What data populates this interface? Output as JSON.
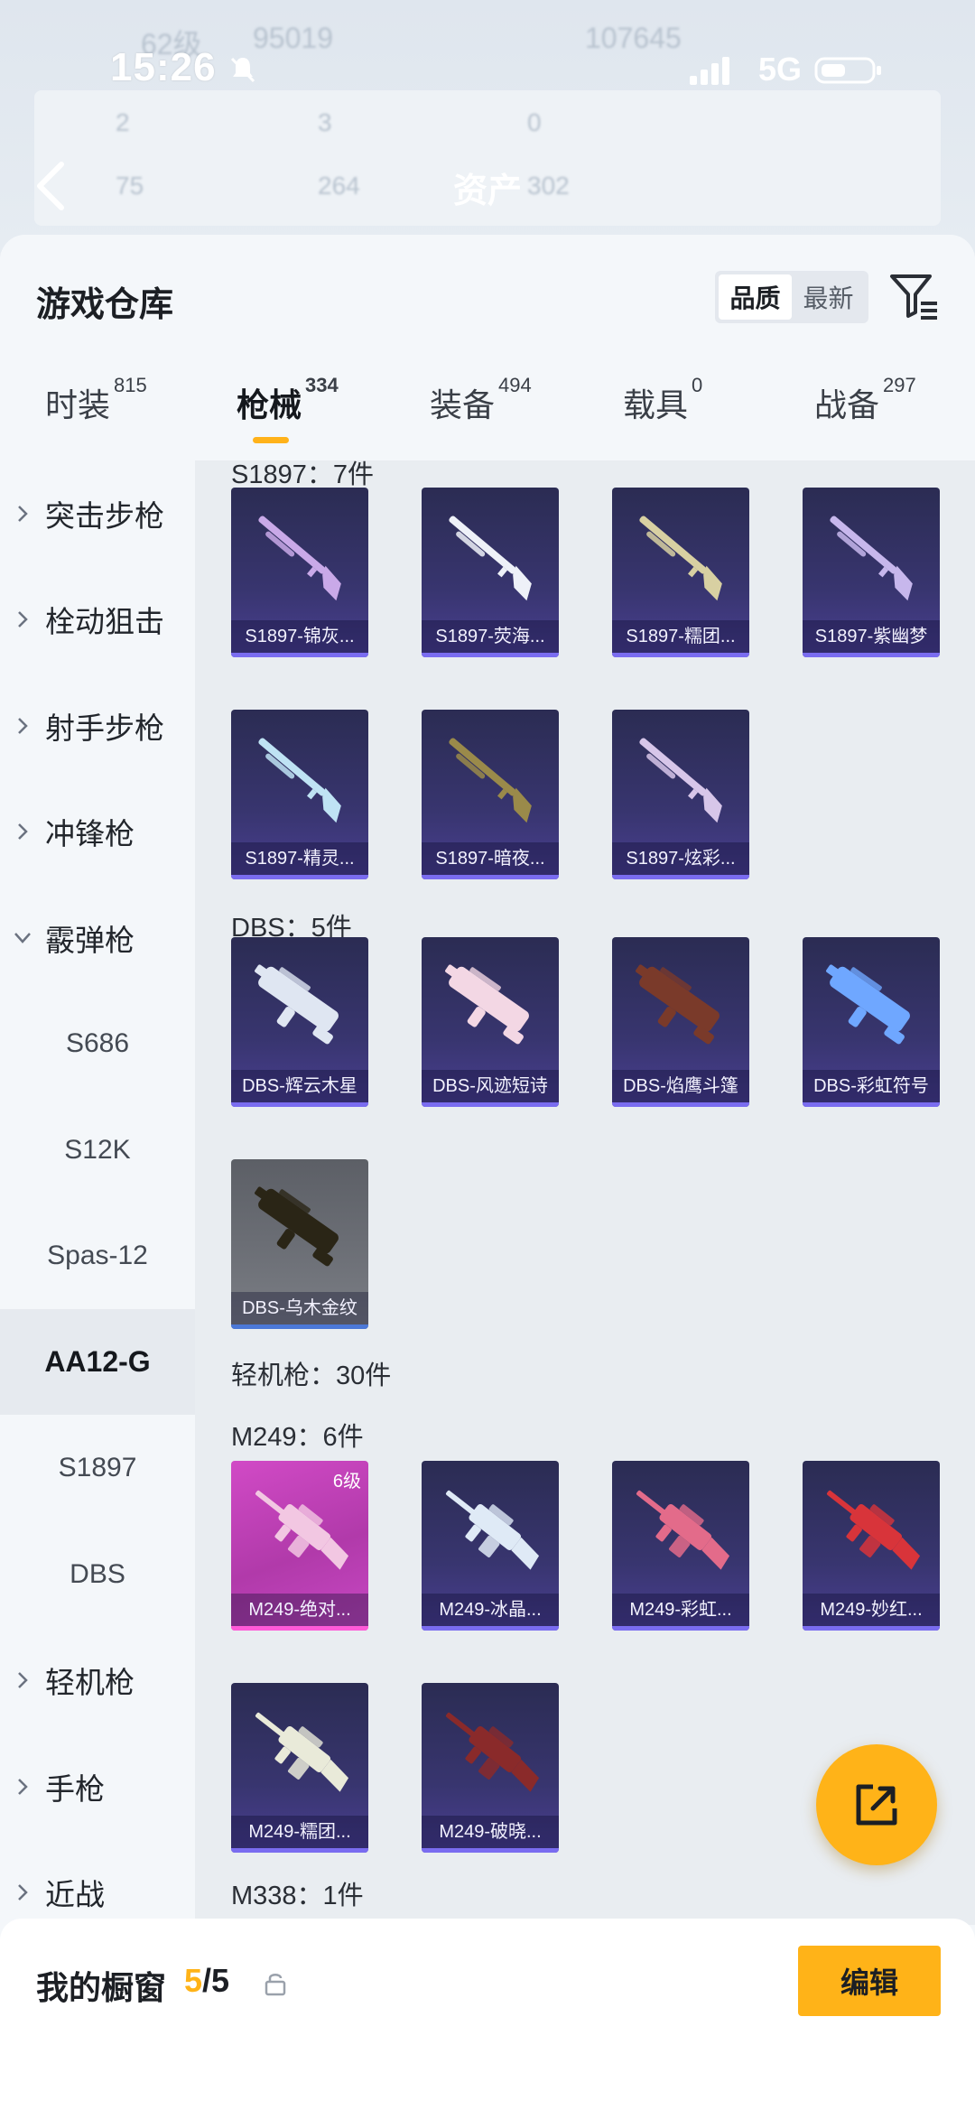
{
  "status_bar": {
    "time": "15:26",
    "network": "5G"
  },
  "background_header": {
    "blur_level": "62级",
    "blur_coins": "95019",
    "blur_points": "107645",
    "blur_stats_row1": [
      "2",
      "3",
      "0"
    ],
    "blur_stats_row2": [
      "75",
      "264",
      "302"
    ],
    "assets_label": "资产"
  },
  "warehouse": {
    "title": "游戏仓库",
    "sort_options": [
      "品质",
      "最新"
    ],
    "sort_selected": "品质"
  },
  "tabs": [
    {
      "label": "时装",
      "count": "815"
    },
    {
      "label": "枪械",
      "count": "334"
    },
    {
      "label": "装备",
      "count": "494"
    },
    {
      "label": "载具",
      "count": "0"
    },
    {
      "label": "战备",
      "count": "297"
    }
  ],
  "sidenav": [
    {
      "label": "突击步枪",
      "type": "category"
    },
    {
      "label": "栓动狙击",
      "type": "category"
    },
    {
      "label": "射手步枪",
      "type": "category"
    },
    {
      "label": "冲锋枪",
      "type": "category"
    },
    {
      "label": "霰弹枪",
      "type": "category-open"
    },
    {
      "label": "S686",
      "type": "sub"
    },
    {
      "label": "S12K",
      "type": "sub"
    },
    {
      "label": "Spas-12",
      "type": "sub"
    },
    {
      "label": "AA12-G",
      "type": "sub-selected"
    },
    {
      "label": "S1897",
      "type": "sub"
    },
    {
      "label": "DBS",
      "type": "sub"
    },
    {
      "label": "轻机枪",
      "type": "category"
    },
    {
      "label": "手枪",
      "type": "category"
    },
    {
      "label": "近战",
      "type": "category"
    }
  ],
  "groups": {
    "s1897_label": "S1897：7件",
    "dbs_label": "DBS：5件",
    "lmg_label": "轻机枪：30件",
    "m249_label": "M249：6件",
    "m338_label": "M338：1件"
  },
  "items": [
    {
      "name": "S1897-锦灰...",
      "style": "purple",
      "gun": "shotgun",
      "color": "#c9a9e8"
    },
    {
      "name": "S1897-荧海...",
      "style": "purple",
      "gun": "shotgun",
      "color": "#eef1f8"
    },
    {
      "name": "S1897-糯团...",
      "style": "purple",
      "gun": "shotgun",
      "color": "#d8d0a2"
    },
    {
      "name": "S1897-紫幽梦",
      "style": "purple",
      "gun": "shotgun",
      "color": "#c7b7ec"
    },
    {
      "name": "S1897-精灵...",
      "style": "purple",
      "gun": "shotgun",
      "color": "#bfe3f4"
    },
    {
      "name": "S1897-暗夜...",
      "style": "purple",
      "gun": "shotgun",
      "color": "#9a8a4a"
    },
    {
      "name": "S1897-炫彩...",
      "style": "purple",
      "gun": "shotgun",
      "color": "#d7c6e9"
    },
    {
      "name": "DBS-辉云木星",
      "style": "purple",
      "gun": "dbs",
      "color": "#dfe6f2"
    },
    {
      "name": "DBS-风迹短诗",
      "style": "purple",
      "gun": "dbs",
      "color": "#f3d7e4"
    },
    {
      "name": "DBS-焰鹰斗篷",
      "style": "purple",
      "gun": "dbs",
      "color": "#7a3a2a"
    },
    {
      "name": "DBS-彩虹符号",
      "style": "purple",
      "gun": "dbs",
      "color": "#6fa7ff"
    },
    {
      "name": "DBS-乌木金纹",
      "style": "grey",
      "gun": "dbs",
      "color": "#2a2516"
    },
    {
      "name": "M249-绝对...",
      "style": "pink",
      "gun": "lmg",
      "color": "#f2c7e2",
      "level": "6级"
    },
    {
      "name": "M249-冰晶...",
      "style": "purple",
      "gun": "lmg",
      "color": "#dfeaf6"
    },
    {
      "name": "M249-彩虹...",
      "style": "purple",
      "gun": "lmg",
      "color": "#e36b8a"
    },
    {
      "name": "M249-妙红...",
      "style": "purple",
      "gun": "lmg",
      "color": "#d8343a"
    },
    {
      "name": "M249-糯团...",
      "style": "purple",
      "gun": "lmg",
      "color": "#e9ead9"
    },
    {
      "name": "M249-破晓...",
      "style": "purple",
      "gun": "lmg",
      "color": "#8a2a2a"
    }
  ],
  "showcase": {
    "label": "我的橱窗",
    "current": "5",
    "total": "/5",
    "edit_label": "编辑"
  },
  "colors": {
    "accent": "#ffb318",
    "card_purple": "#38356f",
    "card_pink": "#c848c4"
  }
}
